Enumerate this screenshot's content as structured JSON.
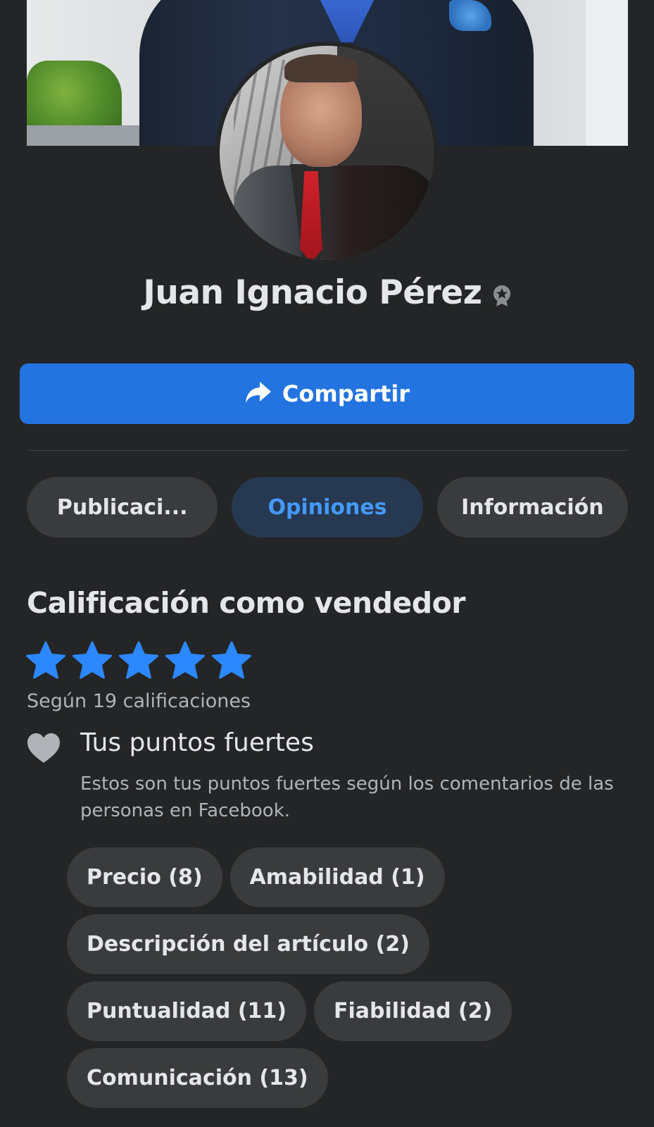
{
  "profile": {
    "name": "Juan Ignacio Pérez",
    "badge_icon": "verified-badge-icon"
  },
  "actions": {
    "share_label": "Compartir",
    "share_icon": "share-arrow-icon"
  },
  "tabs": [
    {
      "label": "Publicaci...",
      "active": false
    },
    {
      "label": "Opiniones",
      "active": true
    },
    {
      "label": "Información",
      "active": false
    }
  ],
  "rating": {
    "title": "Calificación como vendedor",
    "stars": 5,
    "max_stars": 5,
    "count_text": "Según 19 calificaciones"
  },
  "strengths": {
    "icon": "heart-icon",
    "title": "Tus puntos fuertes",
    "description": "Estos son tus puntos fuertes según los comentarios de las personas en Facebook.",
    "chips": [
      "Precio (8)",
      "Amabilidad (1)",
      "Descripción del artículo (2)",
      "Puntualidad (11)",
      "Fiabilidad (2)",
      "Comunicación (13)"
    ]
  },
  "colors": {
    "background": "#242526",
    "primary": "#2374e1",
    "active_tab_bg": "#263951",
    "active_tab_text": "#4599ff",
    "star": "#2d88ff",
    "chip_bg": "#3a3b3c"
  }
}
